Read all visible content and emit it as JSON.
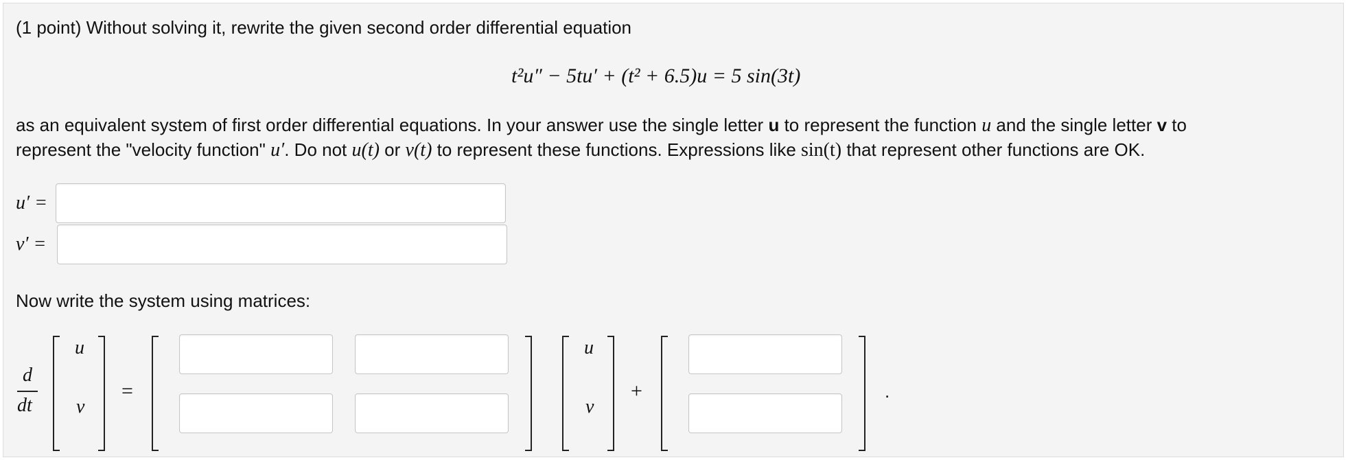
{
  "problem": {
    "intro": "(1 point) Without solving it, rewrite the given second order differential equation",
    "equation": "t²u″ − 5tu′ + (t² + 6.5)u = 5 sin(3t)",
    "line1_a": "as an equivalent system of first order differential equations. In your answer use the single letter ",
    "line1_u_bold": "u",
    "line1_b": " to represent the function ",
    "line1_u_math": "u",
    "line1_c": " and the single letter ",
    "line1_v_bold": "v",
    "line1_d": " to",
    "line2_a": "represent the \"velocity function\" ",
    "line2_uprime": "u′",
    "line2_b": ". Do not ",
    "line2_ut": "u(t)",
    "line2_c": " or ",
    "line2_vt": "v(t)",
    "line2_d": " to represent these functions. Expressions like ",
    "line2_sin": "sin(t)",
    "line2_e": " that represent other functions are OK."
  },
  "system": {
    "uprime_label": "u′ =",
    "vprime_label": "v′ =",
    "uprime_value": "",
    "vprime_value": ""
  },
  "matrices": {
    "prompt": "Now write the system using matrices:",
    "d": "d",
    "dt": "dt",
    "u": "u",
    "v": "v",
    "equals": "=",
    "plus": "+",
    "period": ".",
    "a11": "",
    "a12": "",
    "a21": "",
    "a22": "",
    "b1": "",
    "b2": ""
  }
}
